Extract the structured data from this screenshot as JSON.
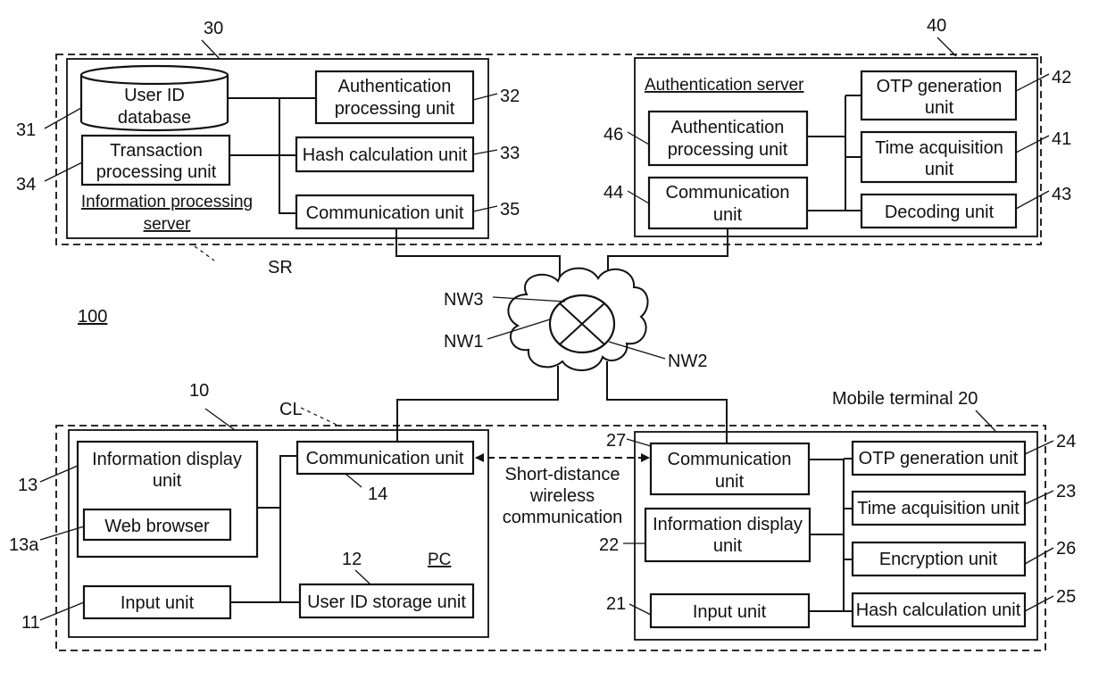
{
  "figure": {
    "system_ref": "100",
    "server_group_ref": "SR",
    "client_group_ref": "CL"
  },
  "info_server": {
    "ref": "30",
    "title_line1": "Information processing",
    "title_line2": "server",
    "user_db": {
      "ref": "31",
      "line1": "User ID",
      "line2": "database"
    },
    "auth_proc": {
      "ref": "32",
      "line1": "Authentication",
      "line2": "processing unit"
    },
    "hash_calc": {
      "ref": "33",
      "label": "Hash calculation unit"
    },
    "transaction": {
      "ref": "34",
      "line1": "Transaction",
      "line2": "processing unit"
    },
    "comm": {
      "ref": "35",
      "label": "Communication unit"
    }
  },
  "auth_server": {
    "ref": "40",
    "title": "Authentication server",
    "otp_gen": {
      "ref": "42",
      "line1": "OTP generation",
      "line2": "unit"
    },
    "time_acq": {
      "ref": "41",
      "line1": "Time acquisition",
      "line2": "unit"
    },
    "decoding": {
      "ref": "43",
      "label": "Decoding unit"
    },
    "auth_proc": {
      "ref": "46",
      "line1": "Authentication",
      "line2": "processing unit"
    },
    "comm": {
      "ref": "44",
      "line1": "Communication",
      "line2": "unit"
    }
  },
  "network": {
    "nw1": "NW1",
    "nw2": "NW2",
    "nw3": "NW3"
  },
  "pc": {
    "ref": "10",
    "title": "PC",
    "info_display": {
      "ref": "13",
      "line1": "Information display",
      "line2": "unit"
    },
    "web_browser": {
      "ref": "13a",
      "label": "Web browser"
    },
    "comm": {
      "ref": "14",
      "label": "Communication unit"
    },
    "input": {
      "ref": "11",
      "label": "Input unit"
    },
    "user_id_storage": {
      "ref": "12",
      "label": "User ID storage unit"
    }
  },
  "short_distance": {
    "line1": "Short-distance",
    "line2": "wireless",
    "line3": "communication"
  },
  "mobile": {
    "title": "Mobile terminal 20",
    "comm": {
      "ref": "27",
      "line1": "Communication",
      "line2": "unit"
    },
    "info_display": {
      "ref": "22",
      "line1": "Information display",
      "line2": "unit"
    },
    "input": {
      "ref": "21",
      "label": "Input unit"
    },
    "otp_gen": {
      "ref": "24",
      "label": "OTP generation unit"
    },
    "time_acq": {
      "ref": "23",
      "label": "Time acquisition unit"
    },
    "encryption": {
      "ref": "26",
      "label": "Encryption unit"
    },
    "hash_calc": {
      "ref": "25",
      "label": "Hash calculation unit"
    }
  }
}
